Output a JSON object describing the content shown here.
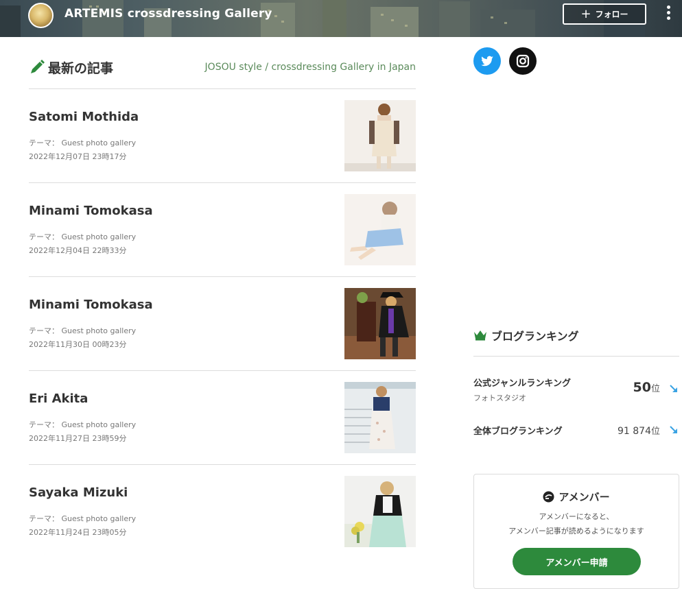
{
  "header": {
    "site_title": "ARTEMIS crossdressing Gallery",
    "follow_label": "フォロー"
  },
  "main": {
    "section_title": "最新の記事",
    "section_subtitle": "JOSOU style / crossdressing Gallery in Japan",
    "articles": [
      {
        "title": "Satomi Mothida",
        "theme": "テーマ： Guest photo gallery",
        "date": "2022年12月07日 23時17分"
      },
      {
        "title": "Minami Tomokasa",
        "theme": "テーマ： Guest photo gallery",
        "date": "2022年12月04日 22時33分"
      },
      {
        "title": "Minami Tomokasa",
        "theme": "テーマ： Guest photo gallery",
        "date": "2022年11月30日 00時23分"
      },
      {
        "title": "Eri Akita",
        "theme": "テーマ： Guest photo gallery",
        "date": "2022年11月27日 23時59分"
      },
      {
        "title": "Sayaka Mizuki",
        "theme": "テーマ： Guest photo gallery",
        "date": "2022年11月24日 23時05分"
      }
    ]
  },
  "sidebar": {
    "ranking": {
      "title": "ブログランキング",
      "genre_label": "公式ジャンルランキング",
      "genre_sub": "フォトスタジオ",
      "genre_rank": "50",
      "overall_label": "全体ブログランキング",
      "overall_rank": "91 874",
      "unit": "位"
    },
    "ameba": {
      "title": "アメンバー",
      "desc_line1": "アメンバーになると、",
      "desc_line2": "アメンバー記事が読めるようになります",
      "button_label": "アメンバー申請"
    }
  },
  "colors": {
    "accent_green": "#2d8a3c",
    "twitter_blue": "#1d9bf0",
    "subtitle_green": "#5a8a5a",
    "rank_arrow_blue": "#3aa3e3"
  }
}
